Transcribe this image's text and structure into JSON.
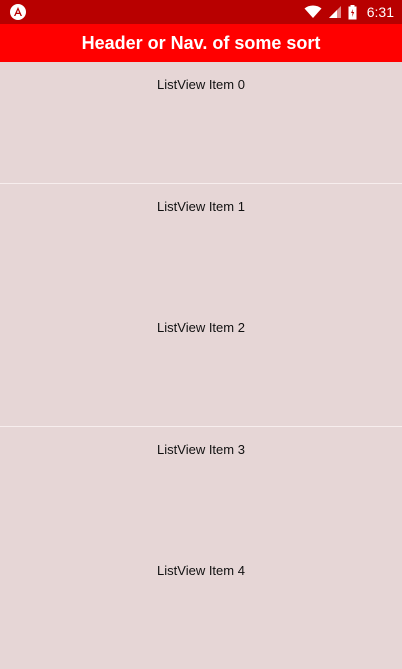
{
  "status_bar": {
    "time": "6:31",
    "app_icon": "angular-logo-icon",
    "wifi_icon": "wifi-icon",
    "signal_icon": "signal-icon",
    "battery_icon": "battery-icon",
    "background_color": "#b80000"
  },
  "header": {
    "title": "Header or Nav. of some sort",
    "background_color": "#ff0000"
  },
  "list": {
    "items": [
      {
        "label": "ListView Item 0"
      },
      {
        "label": "ListView Item 1"
      },
      {
        "label": "ListView Item 2"
      },
      {
        "label": "ListView Item 3"
      },
      {
        "label": "ListView Item 4"
      }
    ],
    "background_color": "#e6d6d6"
  }
}
